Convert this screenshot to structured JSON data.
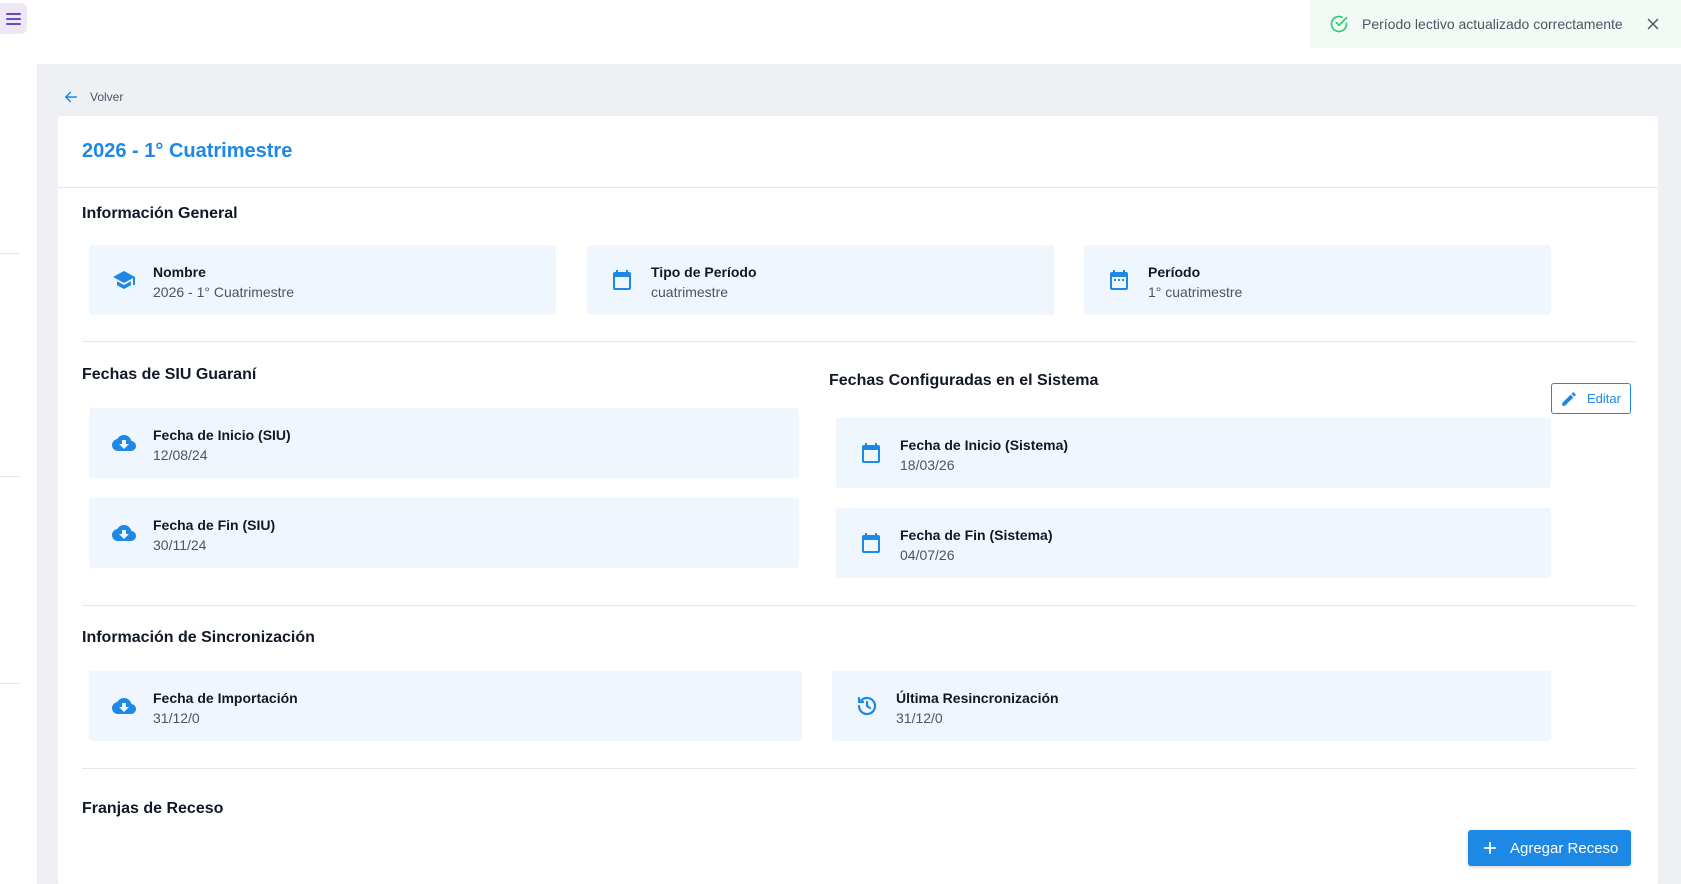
{
  "colors": {
    "accent": "#1e88e5",
    "success": "#2ecc71",
    "box_bg": "#eff6fe"
  },
  "toast": {
    "message": "Período lectivo actualizado correctamente",
    "icon": "check-circle-icon",
    "close_icon": "close-icon"
  },
  "nav": {
    "back_label": "Volver",
    "menu_icon": "hamburger-menu-icon"
  },
  "page": {
    "title": "2026 - 1° Cuatrimestre"
  },
  "general": {
    "title": "Información General",
    "items": [
      {
        "icon": "graduation-cap-icon",
        "label": "Nombre",
        "value": "2026 - 1° Cuatrimestre"
      },
      {
        "icon": "calendar-icon",
        "label": "Tipo de Período",
        "value": "cuatrimestre"
      },
      {
        "icon": "calendar-grid-icon",
        "label": "Período",
        "value": "1° cuatrimestre"
      }
    ]
  },
  "siu": {
    "title": "Fechas de SIU Guaraní",
    "items": [
      {
        "icon": "cloud-download-icon",
        "label": "Fecha de Inicio (SIU)",
        "value": "12/08/24"
      },
      {
        "icon": "cloud-download-icon",
        "label": "Fecha de Fin (SIU)",
        "value": "30/11/24"
      }
    ]
  },
  "system": {
    "title": "Fechas Configuradas en el Sistema",
    "edit_label": "Editar",
    "items": [
      {
        "icon": "calendar-icon",
        "label": "Fecha de Inicio (Sistema)",
        "value": "18/03/26"
      },
      {
        "icon": "calendar-icon",
        "label": "Fecha de Fin (Sistema)",
        "value": "04/07/26"
      }
    ]
  },
  "sync": {
    "title": "Información de Sincronización",
    "items": [
      {
        "icon": "cloud-download-icon",
        "label": "Fecha de Importación",
        "value": "31/12/0"
      },
      {
        "icon": "history-icon",
        "label": "Última Resincronización",
        "value": "31/12/0"
      }
    ]
  },
  "breaks": {
    "title": "Franjas de Receso",
    "add_label": "Agregar Receso"
  }
}
